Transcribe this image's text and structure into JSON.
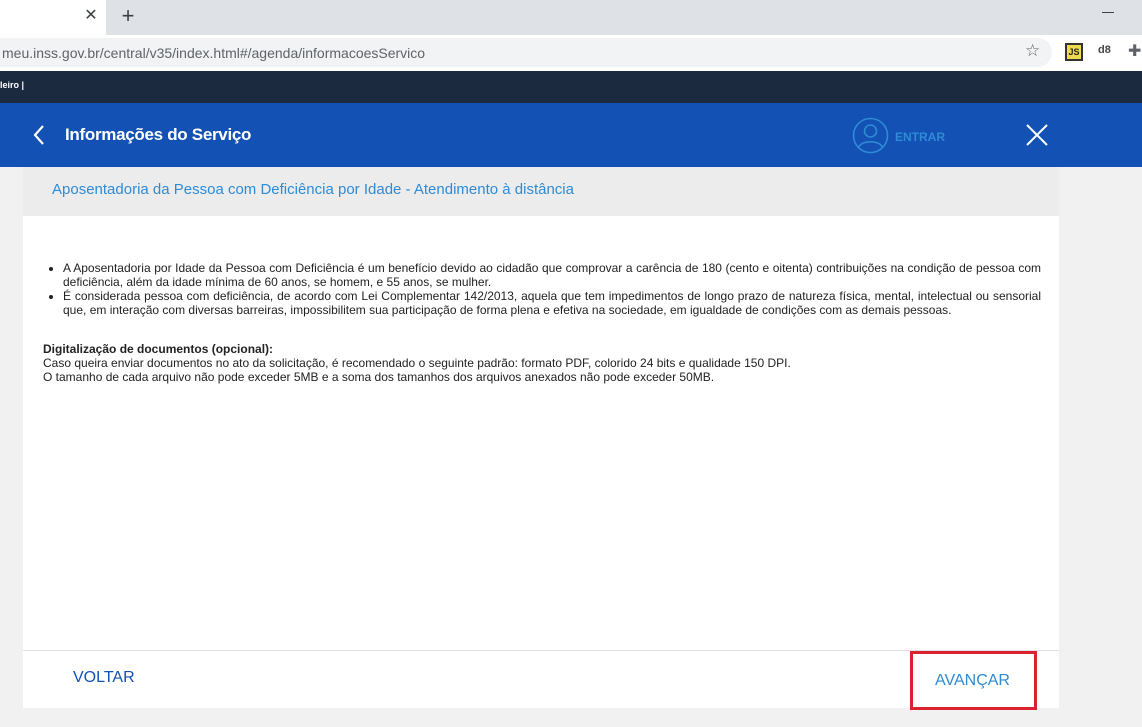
{
  "browser": {
    "url": "meu.inss.gov.br/central/v35/index.html#/agenda/informacoesServico",
    "new_tab_symbol": "+",
    "close_tab_symbol": "✕",
    "star_symbol": "☆",
    "extension_js_label": "JS",
    "extension_db_label": "d8",
    "puzzle_symbol": "✚"
  },
  "gov_bar": {
    "text": "leiro  |"
  },
  "header": {
    "title": "Informações do Serviço",
    "login_label": "ENTRAR",
    "brand_color": "#1351b4"
  },
  "card": {
    "title": "Aposentadoria da Pessoa com Deficiência por Idade - Atendimento à distância",
    "bullets": [
      "A Aposentadoria por Idade da Pessoa com Deficiência é um benefício devido ao cidadão que comprovar a carência de 180 (cento e oitenta) contribuições na condição de pessoa com deficiência, além da idade mínima de 60 anos, se homem, e 55 anos, se mulher.",
      "É considerada pessoa com deficiência, de acordo com Lei Complementar 142/2013, aquela que tem impedimentos de longo prazo de natureza física, mental, intelectual ou sensorial que, em interação com diversas barreiras, impossibilitem sua participação  de forma plena e efetiva na sociedade, em igualdade de condições com as demais pessoas."
    ],
    "docs_title": "Digitalização de documentos (opcional):",
    "docs_line1": "Caso queira enviar documentos no ato da solicitação, é recomendado o seguinte padrão: formato PDF, colorido 24 bits e qualidade 150 DPI.",
    "docs_line2": "O tamanho de cada arquivo não pode exceder 5MB e a soma dos tamanhos dos arquivos anexados não pode exceder 50MB."
  },
  "footer": {
    "back_label": "VOLTAR",
    "next_label": "AVANÇAR",
    "highlight_color": "#d9232f"
  }
}
